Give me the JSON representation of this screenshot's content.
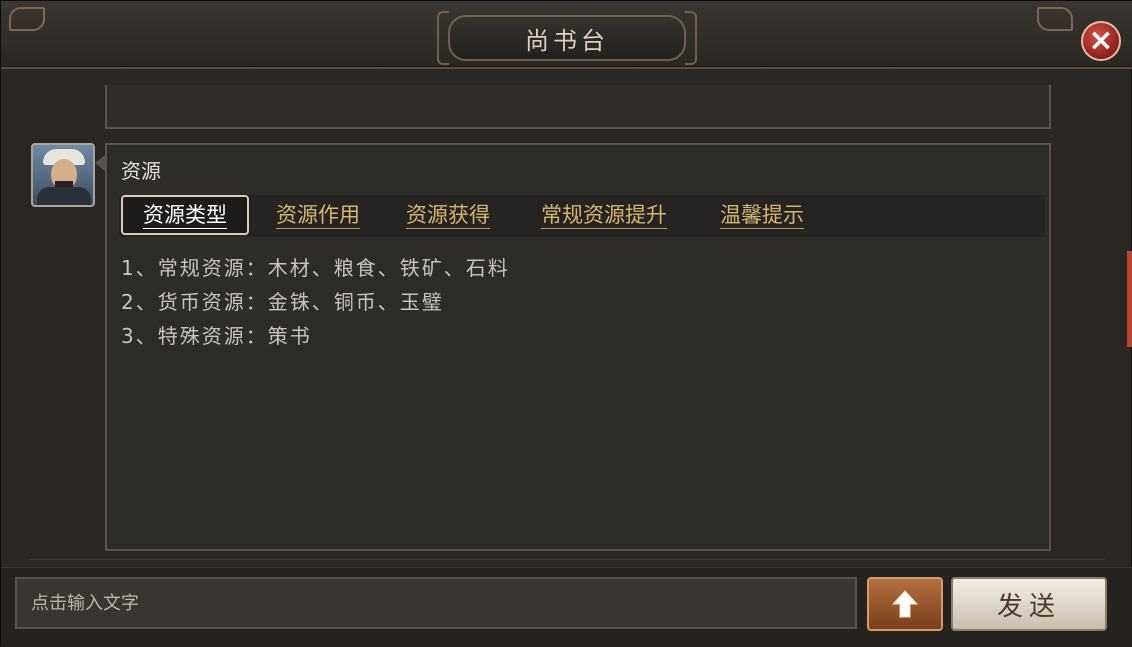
{
  "window": {
    "title": "尚书台",
    "close_icon": "×"
  },
  "message": {
    "heading": "资源",
    "tabs": [
      {
        "label": "资源类型",
        "active": true
      },
      {
        "label": "资源作用",
        "active": false
      },
      {
        "label": "资源获得",
        "active": false
      },
      {
        "label": "常规资源提升",
        "active": false
      },
      {
        "label": "温馨提示",
        "active": false
      }
    ],
    "lines": [
      "1、常规资源：木材、粮食、铁矿、石料",
      "2、货币资源：金铢、铜币、玉璧",
      "3、特殊资源：策书"
    ]
  },
  "input": {
    "placeholder": "点击输入文字",
    "value": ""
  },
  "buttons": {
    "send_label": "发送",
    "up_icon": "up-arrow-icon"
  },
  "colors": {
    "tab_text": "#d6b56f",
    "active_tab_text": "#ffffff",
    "close_button": "#c0392b",
    "up_button": "#9a5530"
  }
}
